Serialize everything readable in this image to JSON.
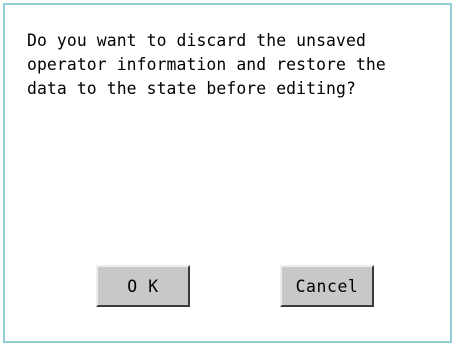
{
  "dialog": {
    "message_lines": [
      "Do you want to discard the unsaved",
      "operator information and restore the",
      "data to the state before editing?"
    ],
    "ok_label": "O K",
    "cancel_label": "Cancel"
  },
  "colors": {
    "border": "#8ed0d6",
    "button_face": "#c8c8c8",
    "button_shadow": "#3a3a3a",
    "button_highlight": "#ededed"
  }
}
